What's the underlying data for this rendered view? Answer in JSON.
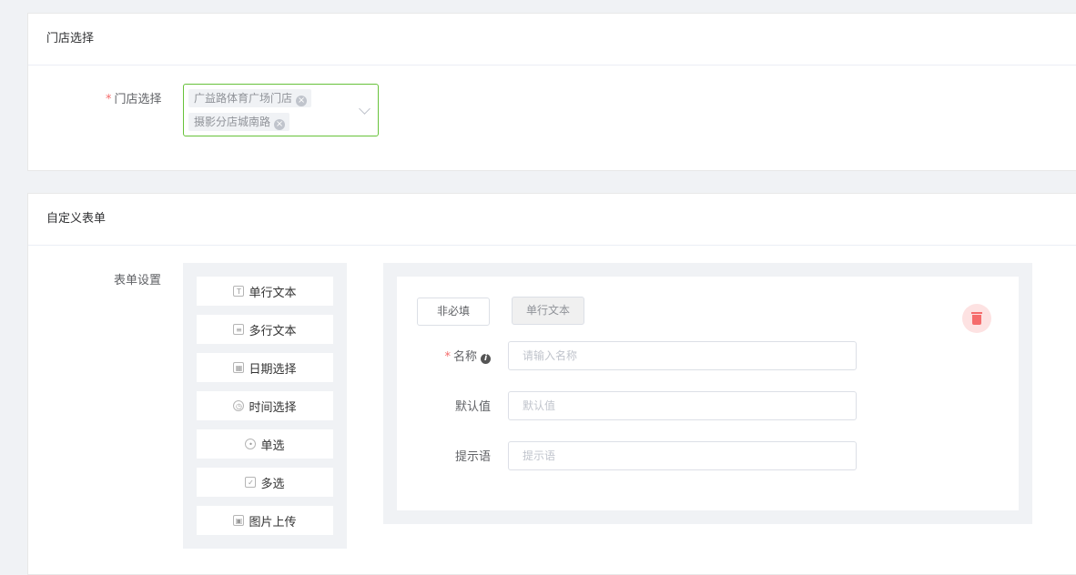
{
  "store_section": {
    "title": "门店选择",
    "label": "门店选择",
    "selected_tags": [
      "广益路体育广场门店",
      "摄影分店城南路"
    ]
  },
  "form_section": {
    "title": "自定义表单",
    "settings_label": "表单设置",
    "palette": [
      {
        "label": "单行文本",
        "icon": "text-field-icon"
      },
      {
        "label": "多行文本",
        "icon": "textarea-icon"
      },
      {
        "label": "日期选择",
        "icon": "calendar-icon"
      },
      {
        "label": "时间选择",
        "icon": "clock-icon"
      },
      {
        "label": "单选",
        "icon": "radio-icon"
      },
      {
        "label": "多选",
        "icon": "checkbox-icon"
      },
      {
        "label": "图片上传",
        "icon": "image-icon"
      }
    ],
    "editor": {
      "optional_button": "非必填",
      "type_badge": "单行文本",
      "fields": [
        {
          "label": "名称",
          "placeholder": "请输入名称",
          "required": true
        },
        {
          "label": "默认值",
          "placeholder": "默认值"
        },
        {
          "label": "提示语",
          "placeholder": "提示语"
        }
      ]
    }
  },
  "colors": {
    "required": "#f56c6c",
    "focus_border": "#67c23a",
    "delete_bg": "#fde2e2"
  }
}
